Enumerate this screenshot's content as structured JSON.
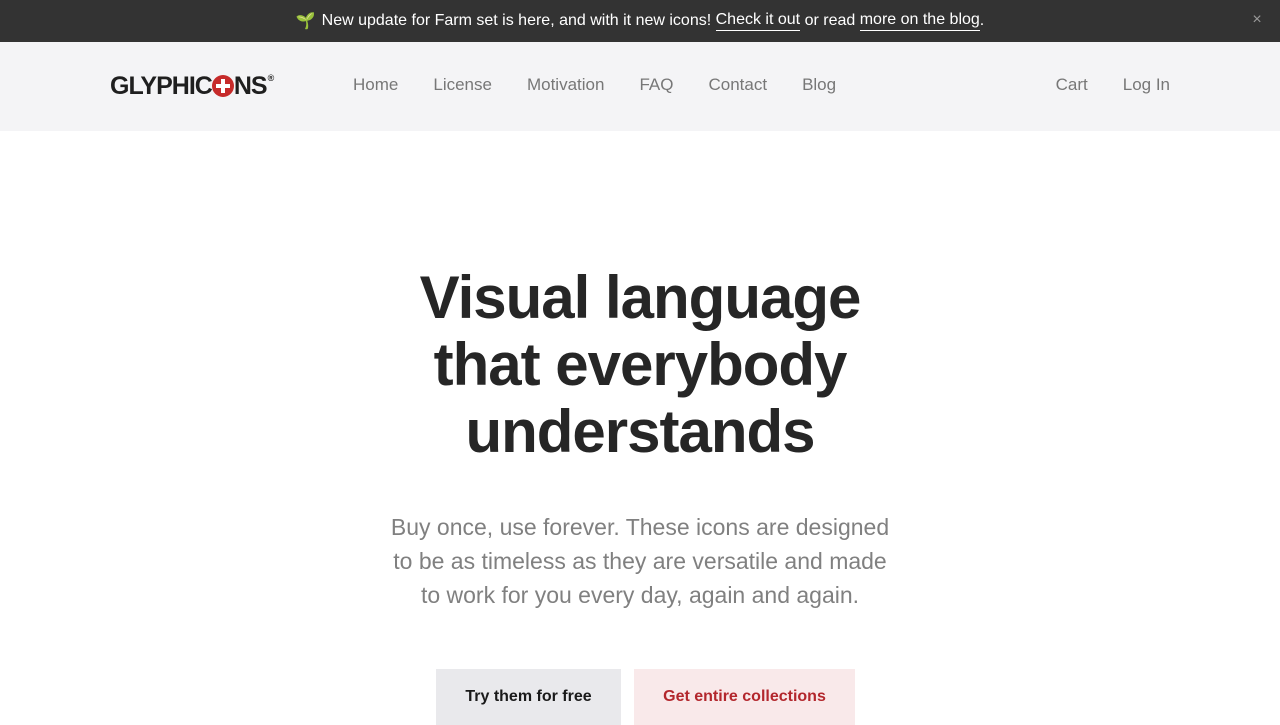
{
  "announcement": {
    "emoji": "🌱",
    "text_before": "New update for Farm set is here, and with it new icons!",
    "link1": "Check it out",
    "text_middle": "or read",
    "link2": "more on the blog",
    "text_after": ".",
    "close_symbol": "×"
  },
  "header": {
    "logo_left": "GLYPHIC",
    "logo_right": "NS",
    "logo_mark": "®",
    "nav": [
      "Home",
      "License",
      "Motivation",
      "FAQ",
      "Contact",
      "Blog"
    ],
    "nav_right": [
      "Cart",
      "Log In"
    ]
  },
  "hero": {
    "title_line1": "Visual language",
    "title_line2": "that everybody",
    "title_line3": "understands",
    "subtitle_line1": "Buy once, use forever. These icons are designed",
    "subtitle_line2": "to be as timeless as they are versatile and made",
    "subtitle_line3": "to work for you every day, again and again."
  },
  "buttons": {
    "free": "Try them for free",
    "collections": "Get entire collections"
  },
  "colors": {
    "accent": "#c62a2a",
    "announce_bg": "#333333",
    "header_bg": "#f4f4f6"
  },
  "icons": {
    "announcement_emoji": "sprout-icon",
    "close": "close-icon",
    "logo_o": "cross-icon"
  }
}
